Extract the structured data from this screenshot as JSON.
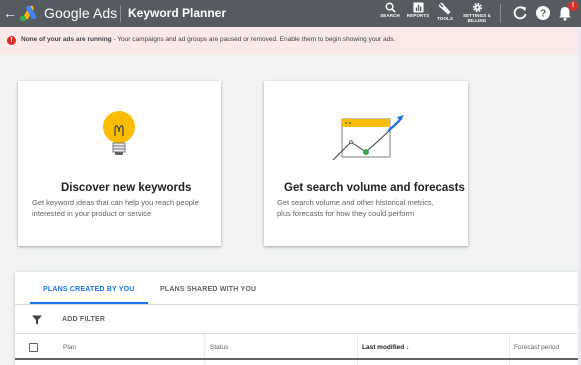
{
  "topbar": {
    "brand": "Google Ads",
    "page_title": "Keyword Planner",
    "tools": [
      {
        "icon": "search-icon",
        "label": "SEARCH"
      },
      {
        "icon": "reports-icon",
        "label": "REPORTS"
      },
      {
        "icon": "wrench-icon",
        "label": "TOOLS"
      },
      {
        "icon": "gear-icon",
        "label_line1": "SETTINGS &",
        "label_line2": "BILLING"
      }
    ],
    "notification_count": "!"
  },
  "alert": {
    "bold": "None of your ads are running",
    "rest": " - Your campaigns and ad groups are paused or removed. Enable them to begin showing your ads."
  },
  "cards": {
    "discover": {
      "title": "Discover new keywords",
      "desc_line1": "Get keyword ideas that can help you reach people",
      "desc_line2": "interested in your product or service"
    },
    "forecast": {
      "title": "Get search volume and forecasts",
      "desc_line1": "Get search volume and other historical metrics,",
      "desc_line2": "plus forecasts for how they could perform"
    }
  },
  "plans": {
    "tabs": [
      "PLANS CREATED BY YOU",
      "PLANS SHARED WITH YOU"
    ],
    "add_filter": "ADD FILTER",
    "columns": [
      "Plan",
      "Status",
      "Last modified",
      "Forecast period"
    ],
    "sort_indicator": "↓"
  },
  "colors": {
    "accent": "#1a73e8",
    "topbar": "#555b61",
    "alert_bg": "#fbe9e7",
    "error": "#d93025"
  }
}
